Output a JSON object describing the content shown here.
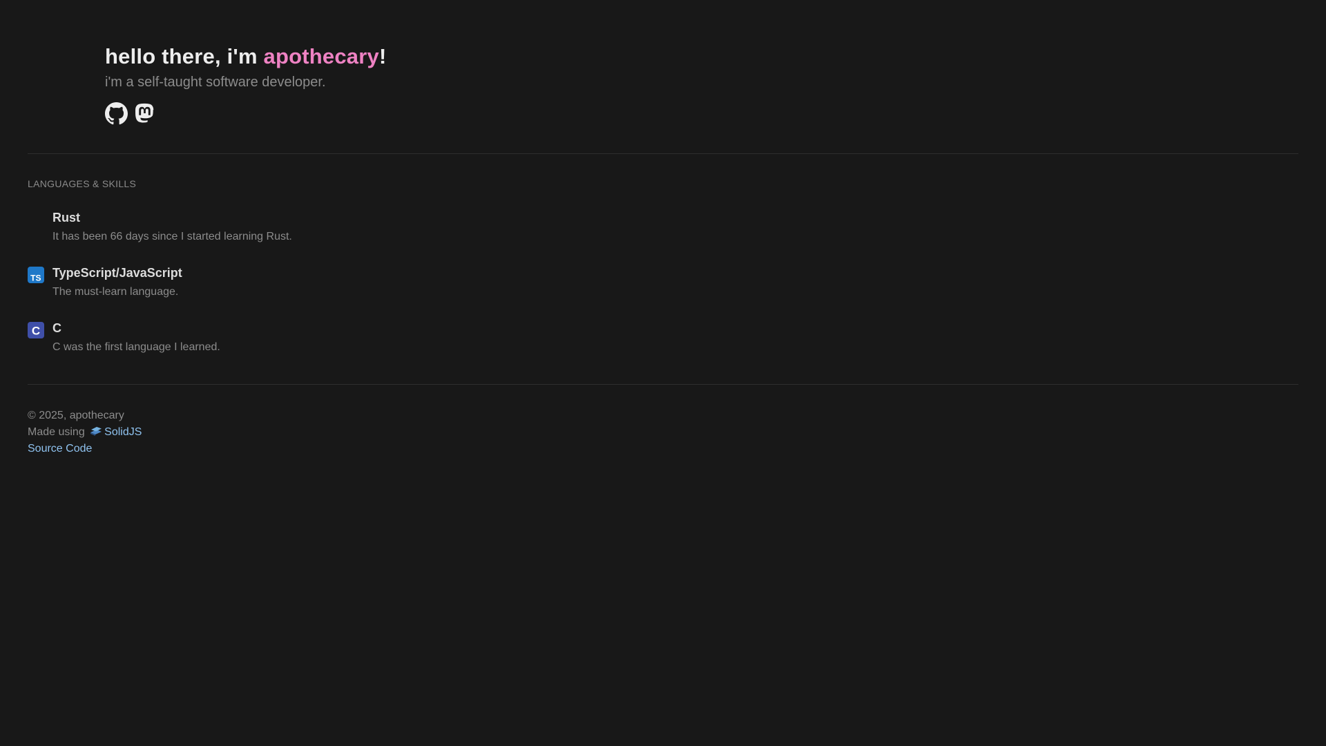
{
  "hero": {
    "greeting_prefix": "hello there, i'm ",
    "name": "apothecary",
    "greeting_suffix": "!",
    "subtitle": "i'm a self-taught software developer.",
    "socials": [
      {
        "icon": "github-icon"
      },
      {
        "icon": "mastodon-icon"
      }
    ]
  },
  "skills": {
    "heading": "LANGUAGES & SKILLS",
    "items": [
      {
        "name": "Rust",
        "description": "It has been 66 days since I started learning Rust.",
        "icon": "rust-icon"
      },
      {
        "name": "TypeScript/JavaScript",
        "description": "The must-learn language.",
        "icon": "typescript-icon",
        "icon_text": "TS",
        "icon_color": "#1f78c8"
      },
      {
        "name": "C",
        "description": "C was the first language I learned.",
        "icon": "c-language-icon",
        "icon_text": "C",
        "icon_color": "#3f4fa8"
      }
    ]
  },
  "footer": {
    "copyright": "© 2025, apothecary",
    "made_using_prefix": "Made using ",
    "framework_link": "SolidJS",
    "framework_icon": "solidjs-icon",
    "source_link": "Source Code"
  },
  "colors": {
    "background": "#181818",
    "accent_pink": "#ee82c3",
    "link_blue": "#8fc2ef",
    "text_primary": "#ededed",
    "text_muted": "#8c8c8c"
  }
}
